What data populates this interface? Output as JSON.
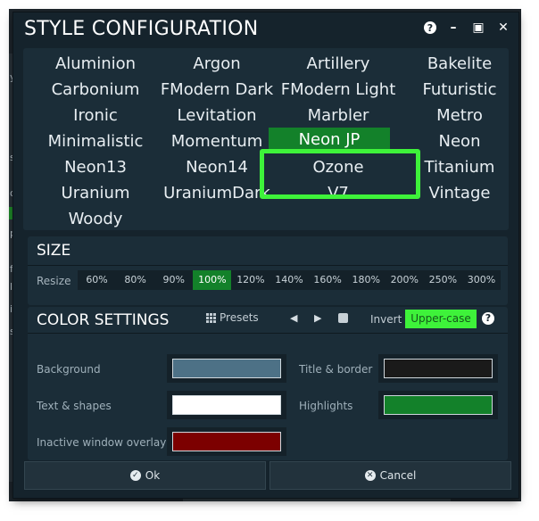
{
  "dialog": {
    "title": "STYLE CONFIGURATION",
    "title_icons": [
      "help-icon",
      "minimize-icon",
      "maximize-icon",
      "close-icon"
    ]
  },
  "styles": {
    "items": [
      {
        "label": "Aluminion",
        "col": 0,
        "row": 0
      },
      {
        "label": "Argon",
        "col": 1,
        "row": 0
      },
      {
        "label": "Artillery",
        "col": 2,
        "row": 0
      },
      {
        "label": "Bakelite",
        "col": 3,
        "row": 0
      },
      {
        "label": "Carbonium",
        "col": 0,
        "row": 1
      },
      {
        "label": "FModern Dark",
        "col": 1,
        "row": 1
      },
      {
        "label": "FModern Light",
        "col": 2,
        "row": 1
      },
      {
        "label": "Futuristic",
        "col": 3,
        "row": 1
      },
      {
        "label": "Ironic",
        "col": 0,
        "row": 2
      },
      {
        "label": "Levitation",
        "col": 1,
        "row": 2
      },
      {
        "label": "Marbler",
        "col": 2,
        "row": 2
      },
      {
        "label": "Metro",
        "col": 3,
        "row": 2
      },
      {
        "label": "Minimalistic",
        "col": 0,
        "row": 3
      },
      {
        "label": "Momentum",
        "col": 1,
        "row": 3
      },
      {
        "label": "Neon JP",
        "col": 2,
        "row": 3,
        "selected": true
      },
      {
        "label": "Neon",
        "col": 3,
        "row": 3
      },
      {
        "label": "Neon13",
        "col": 0,
        "row": 4
      },
      {
        "label": "Neon14",
        "col": 1,
        "row": 4
      },
      {
        "label": "Ozone",
        "col": 2,
        "row": 4
      },
      {
        "label": "Titanium",
        "col": 3,
        "row": 4
      },
      {
        "label": "Uranium",
        "col": 0,
        "row": 5
      },
      {
        "label": "UraniumDark",
        "col": 1,
        "row": 5
      },
      {
        "label": "V7",
        "col": 2,
        "row": 5
      },
      {
        "label": "Vintage",
        "col": 3,
        "row": 5
      },
      {
        "label": "Woody",
        "col": 0,
        "row": 6
      }
    ]
  },
  "size": {
    "title": "SIZE",
    "resize_label": "Resize",
    "options": [
      "60%",
      "80%",
      "90%",
      "100%",
      "120%",
      "140%",
      "160%",
      "180%",
      "200%",
      "250%",
      "300%"
    ],
    "selected": "100%"
  },
  "colors": {
    "title": "COLOR SETTINGS",
    "presets_label": "Presets",
    "invert_label": "Invert",
    "uppercase_label": "Upper-case",
    "fields": {
      "background": {
        "label": "Background",
        "color": "#4d7186"
      },
      "text_shapes": {
        "label": "Text & shapes",
        "color": "#ffffff"
      },
      "inactive_overlay": {
        "label": "Inactive window overlay",
        "color": "#7c0000"
      },
      "title_border": {
        "label": "Title & border",
        "color": "#1a1a1a"
      },
      "highlights": {
        "label": "Highlights",
        "color": "#13812a"
      }
    },
    "accent": "#3ef23a"
  },
  "buttons": {
    "ok_label": "Ok",
    "cancel_label": "Cancel"
  },
  "background_app": {
    "side_letters": [
      "y",
      "s",
      "o",
      "p",
      "f",
      "l",
      "i",
      "s"
    ]
  }
}
